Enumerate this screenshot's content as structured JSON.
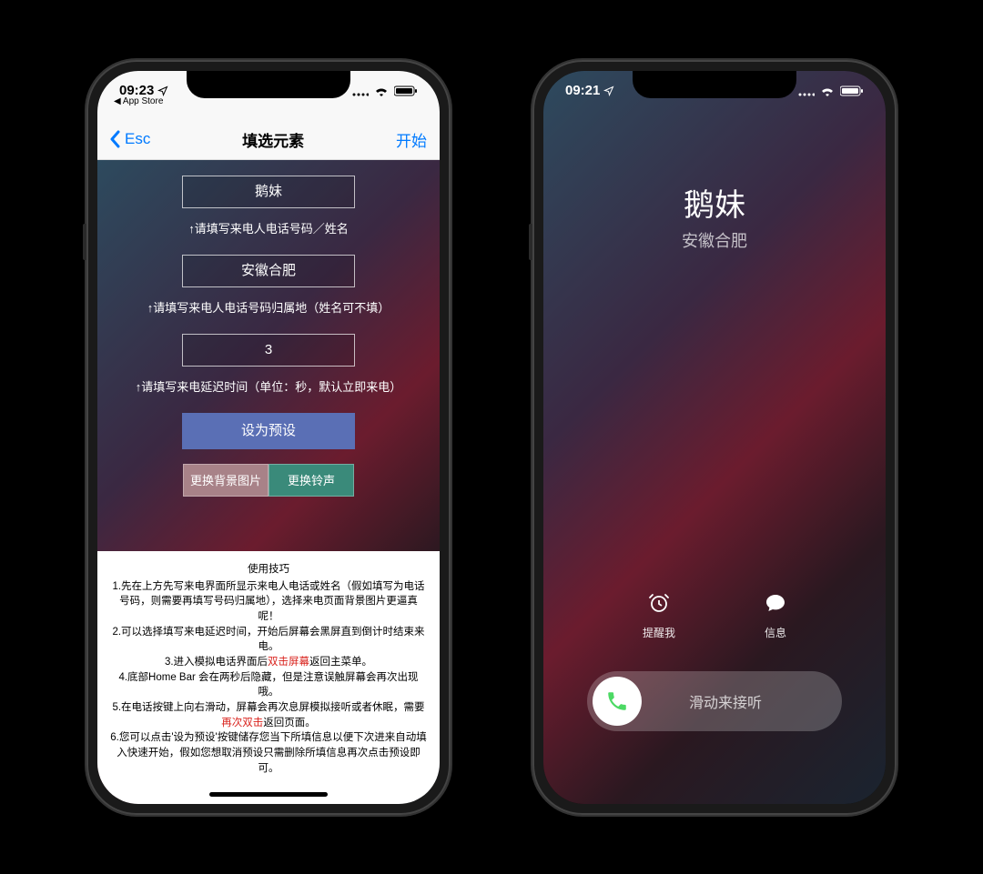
{
  "phone1": {
    "status": {
      "time": "09:23",
      "back_app": "◀ App Store"
    },
    "nav": {
      "back": "Esc",
      "title": "填选元素",
      "action": "开始"
    },
    "form": {
      "name_value": "鹅妹",
      "name_hint": "↑请填写来电人电话号码／姓名",
      "loc_value": "安徽合肥",
      "loc_hint": "↑请填写来电人电话号码归属地（姓名可不填）",
      "delay_value": "3",
      "delay_hint": "↑请填写来电延迟时间（单位：秒，默认立即来电）",
      "preset_btn": "设为预设",
      "bg_btn": "更换背景图片",
      "ring_btn": "更换铃声"
    },
    "tips": {
      "title": "使用技巧",
      "line1": "1.先在上方先写来电界面所显示来电人电话或姓名（假如填写为电话号码，则需要再填写号码归属地），选择来电页面背景图片更逼真呢！",
      "line2": "2.可以选择填写来电延迟时间，开始后屏幕会黑屏直到倒计时结束来电。",
      "line3a": "3.进入模拟电话界面后",
      "line3b": "双击屏幕",
      "line3c": "返回主菜单。",
      "line4": "4.底部Home Bar 会在两秒后隐藏，但是注意误触屏幕会再次出现哦。",
      "line5a": "5.在电话按键上向右滑动，屏幕会再次息屏模拟接听或者休眠，需要",
      "line5b": "再次双击",
      "line5c": "返回页面。",
      "line6": "6.您可以点击'设为预设'按键储存您当下所填信息以便下次进来自动填入快速开始，假如您想取消预设只需删除所填信息再次点击预设即可。"
    }
  },
  "phone2": {
    "status": {
      "time": "09:21"
    },
    "caller": {
      "name": "鹅妹",
      "location": "安徽合肥"
    },
    "options": {
      "remind": "提醒我",
      "message": "信息"
    },
    "slide": "滑动来接听"
  }
}
